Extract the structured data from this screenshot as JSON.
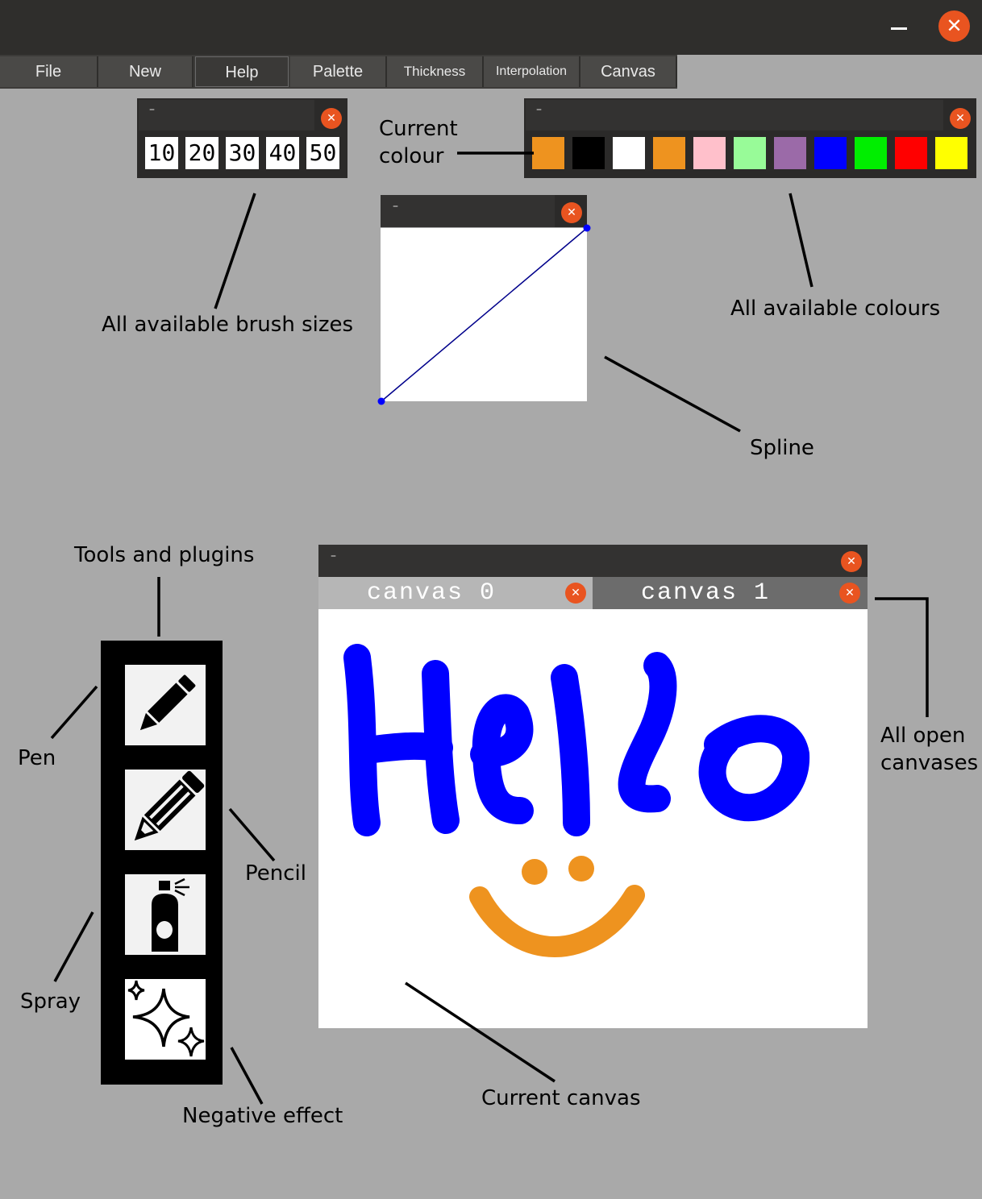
{
  "window": {
    "minimize_glyph": "–",
    "close_glyph": "✕"
  },
  "menu": [
    {
      "label": "File"
    },
    {
      "label": "New"
    },
    {
      "label": "Help"
    },
    {
      "label": "Palette"
    },
    {
      "label": "Thickness"
    },
    {
      "label": "Interpolation"
    },
    {
      "label": "Canvas"
    }
  ],
  "panels": {
    "minimize_glyph": "–",
    "close_glyph": "✕"
  },
  "brush_sizes": [
    "10",
    "20",
    "30",
    "40",
    "50"
  ],
  "palette": {
    "current_colour": "#ee931f",
    "colours": [
      "#000000",
      "#ffffff",
      "#ee931f",
      "#ffc0cb",
      "#98fb98",
      "#9b6aa8",
      "#0000ff",
      "#00ee00",
      "#ff0000",
      "#ffff00"
    ]
  },
  "spline": {
    "start_point": [
      0,
      0
    ],
    "end_point": [
      1,
      1
    ],
    "line_colour": "#00008b",
    "point_colour": "#0000ff"
  },
  "tools": [
    {
      "name": "pen-icon"
    },
    {
      "name": "pencil-icon"
    },
    {
      "name": "spray-icon"
    },
    {
      "name": "sparkle-icon"
    }
  ],
  "canvas_window": {
    "tabs": [
      {
        "label": "canvas 0",
        "active": true
      },
      {
        "label": "canvas 1",
        "active": false
      }
    ],
    "drawing": {
      "text_colour": "#0000ff",
      "smile_colour": "#ee931f"
    }
  },
  "annotations": {
    "current_colour_line1": "Current",
    "current_colour_line2": "colour",
    "brush_sizes": "All available brush sizes",
    "all_colours": "All available colours",
    "spline": "Spline",
    "tools_and_plugins": "Tools and plugins",
    "pen": "Pen",
    "pencil": "Pencil",
    "spray": "Spray",
    "negative_effect": "Negative effect",
    "all_open_line1": "All open",
    "all_open_line2": "canvases",
    "current_canvas": "Current canvas"
  },
  "accent_colour": "#e95420"
}
